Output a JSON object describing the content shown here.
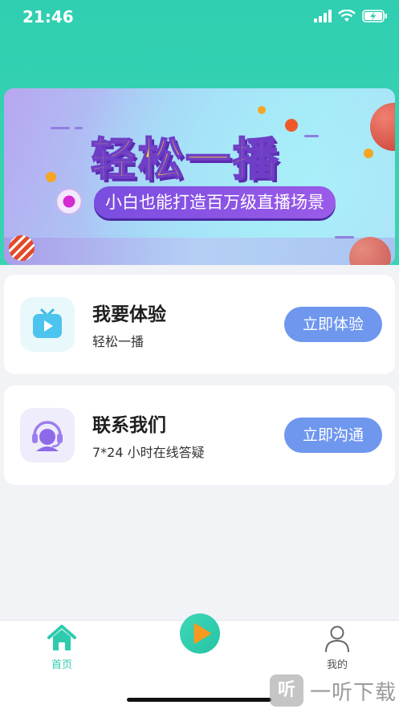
{
  "status_bar": {
    "time": "21:46"
  },
  "banner": {
    "title": "轻松一播",
    "subtitle": "小白也能打造百万级直播场景"
  },
  "cards": [
    {
      "title": "我要体验",
      "subtitle": "轻松一播",
      "button": "立即体验",
      "icon": "tv-play-icon"
    },
    {
      "title": "联系我们",
      "subtitle": "7*24 小时在线答疑",
      "button": "立即沟通",
      "icon": "headset-support-icon"
    }
  ],
  "tabbar": {
    "home_label": "首页",
    "mine_label": "我的"
  },
  "watermark": {
    "icon_text": "听",
    "text": "一听下载"
  },
  "colors": {
    "header": "#30cfb1",
    "accent": "#2fcbae",
    "button": "#6f97ee",
    "banner_title": "#ffe11f",
    "banner_pill": "#7a4de0"
  }
}
